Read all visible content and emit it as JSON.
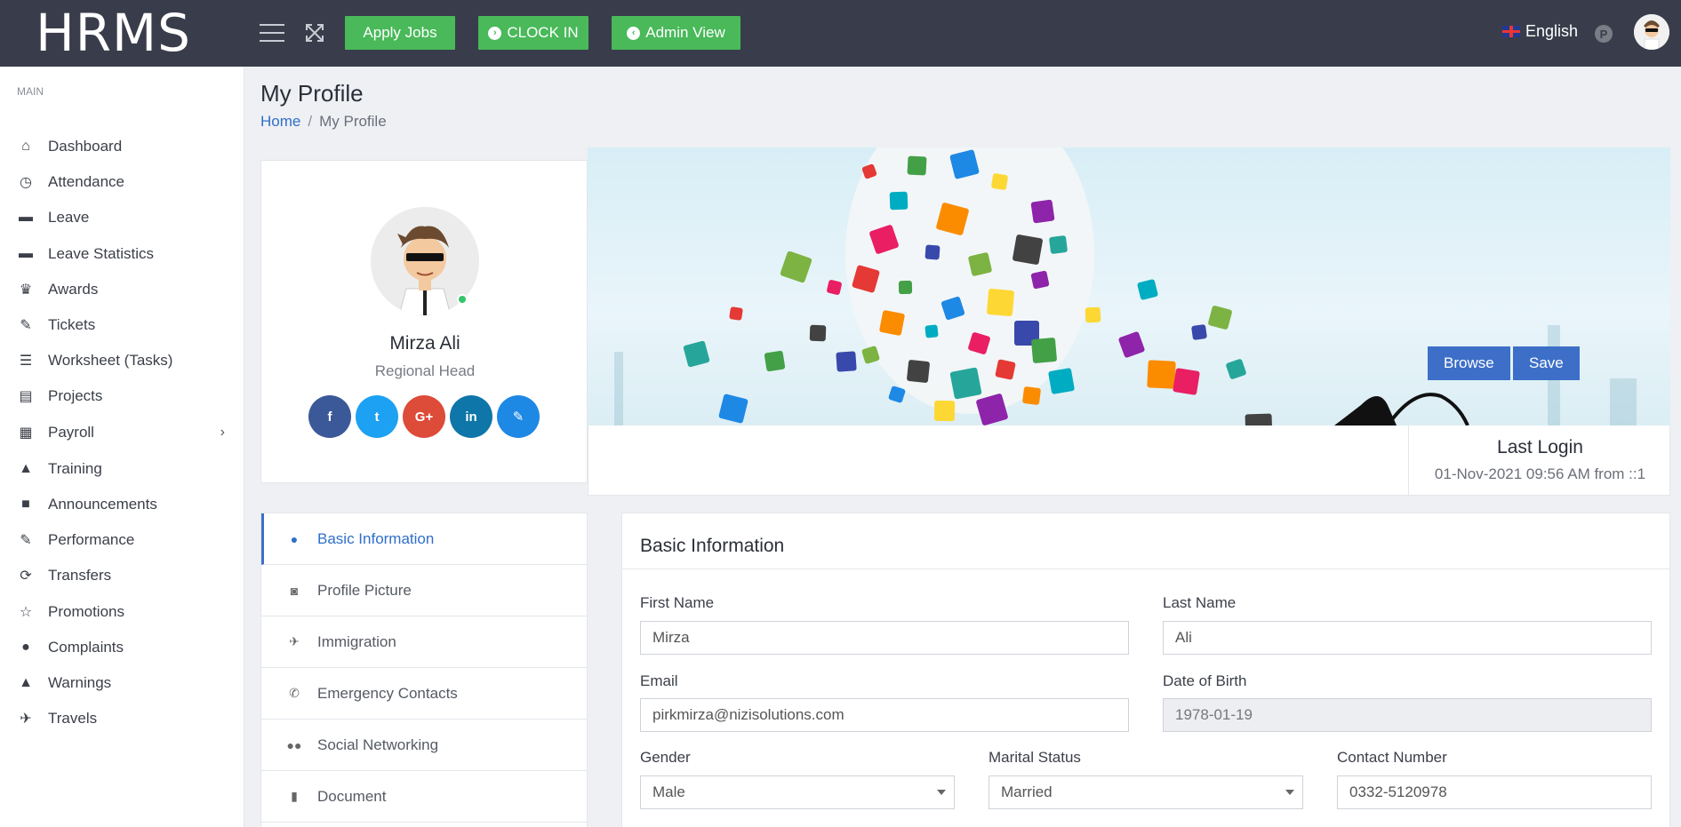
{
  "app": {
    "brand": "HRMS"
  },
  "topbar": {
    "apply_jobs": "Apply Jobs",
    "clock_in": "CLOCK IN",
    "admin_view": "Admin View",
    "language": "English",
    "p_badge": "P"
  },
  "sidebar": {
    "section": "MAIN",
    "items": [
      {
        "label": "Dashboard",
        "icon": "home-icon"
      },
      {
        "label": "Attendance",
        "icon": "clock-icon"
      },
      {
        "label": "Leave",
        "icon": "bed-icon"
      },
      {
        "label": "Leave Statistics",
        "icon": "bed-icon"
      },
      {
        "label": "Awards",
        "icon": "trophy-icon"
      },
      {
        "label": "Tickets",
        "icon": "ticket-icon"
      },
      {
        "label": "Worksheet (Tasks)",
        "icon": "list-icon"
      },
      {
        "label": "Projects",
        "icon": "archive-icon"
      },
      {
        "label": "Payroll",
        "icon": "calculator-icon"
      },
      {
        "label": "Training",
        "icon": "graduation-cap-icon"
      },
      {
        "label": "Announcements",
        "icon": "sticky-note-icon"
      },
      {
        "label": "Performance",
        "icon": "edit-icon"
      },
      {
        "label": "Transfers",
        "icon": "refresh-icon"
      },
      {
        "label": "Promotions",
        "icon": "star-icon"
      },
      {
        "label": "Complaints",
        "icon": "exclamation-circle-icon"
      },
      {
        "label": "Warnings",
        "icon": "warning-icon"
      },
      {
        "label": "Travels",
        "icon": "plane-icon"
      }
    ]
  },
  "page": {
    "title": "My Profile",
    "breadcrumb_home": "Home",
    "breadcrumb_sep": "/",
    "breadcrumb_current": "My Profile"
  },
  "profile": {
    "name": "Mirza Ali",
    "role": "Regional Head",
    "socials": [
      {
        "name": "facebook",
        "glyph": "f",
        "color": "#3b5998"
      },
      {
        "name": "twitter",
        "glyph": "t",
        "color": "#1da1f2"
      },
      {
        "name": "google-plus",
        "glyph": "G+",
        "color": "#dd4b39"
      },
      {
        "name": "linkedin",
        "glyph": "in",
        "color": "#0e76a8"
      },
      {
        "name": "edit",
        "glyph": "✎",
        "color": "#1e88e5"
      }
    ]
  },
  "cover": {
    "browse": "Browse",
    "save": "Save"
  },
  "last_login": {
    "title": "Last Login",
    "value": "01-Nov-2021 09:56 AM from ::1"
  },
  "tabs": [
    {
      "label": "Basic Information",
      "icon": "user-icon",
      "active": true
    },
    {
      "label": "Profile Picture",
      "icon": "camera-icon"
    },
    {
      "label": "Immigration",
      "icon": "plane-icon"
    },
    {
      "label": "Emergency Contacts",
      "icon": "phone-icon"
    },
    {
      "label": "Social Networking",
      "icon": "users-icon"
    },
    {
      "label": "Document",
      "icon": "file-icon"
    }
  ],
  "form": {
    "title": "Basic Information",
    "first_name_label": "First Name",
    "first_name": "Mirza",
    "last_name_label": "Last Name",
    "last_name": "Ali",
    "email_label": "Email",
    "email": "pirkmirza@nizisolutions.com",
    "dob_label": "Date of Birth",
    "dob": "1978-01-19",
    "gender_label": "Gender",
    "gender": "Male",
    "marital_label": "Marital Status",
    "marital": "Married",
    "contact_label": "Contact Number",
    "contact": "0332-5120978"
  },
  "colors": {
    "topbar": "#393d4b",
    "green_button": "#49b95a",
    "primary": "#3d6fc8",
    "link": "#2f6fc9"
  }
}
